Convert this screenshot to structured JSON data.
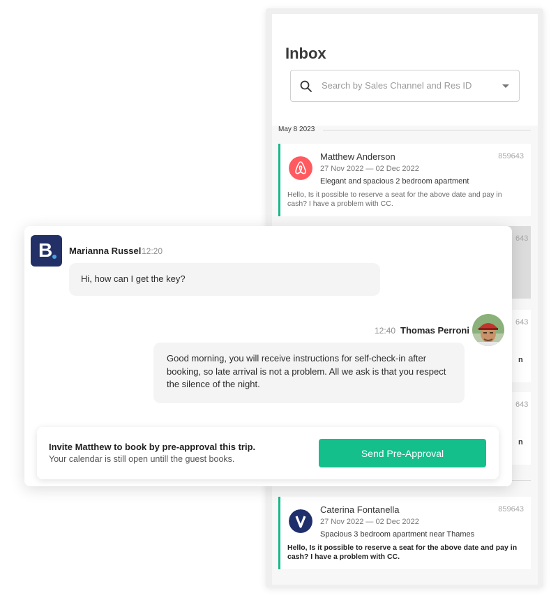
{
  "inbox": {
    "title": "Inbox",
    "search_placeholder": "Search by Sales Channel and Res ID",
    "date_group": "May 8 2023",
    "cards": [
      {
        "name": "Matthew Anderson",
        "res_id": "859643",
        "dates": "27 Nov 2022 — 02 Dec 2022",
        "listing": "Elegant and spacious 2 bedroom apartment",
        "message": "Hello, Is it possible to reserve a seat for the above date and pay in cash? I have a problem with CC.",
        "channel_icon": "airbnb-icon",
        "accent": "#ff5a5f"
      },
      {
        "res_id_fragment": "643"
      },
      {
        "res_id_fragment": "643",
        "text_fragment": "n"
      },
      {
        "res_id_fragment": "643",
        "text_fragment": "n"
      },
      {
        "name": "Caterina Fontanella",
        "res_id": "859643",
        "dates": "27 Nov 2022 — 02 Dec 2022",
        "listing": "Spacious 3 bedroom apartment near Thames",
        "message": "Hello, Is it possible to reserve a seat for the above date and pay in cash? I have a problem with CC.",
        "channel_icon": "vrbo-icon",
        "accent": "#1e2f6b"
      }
    ]
  },
  "chat": {
    "host_message": {
      "sender": "Marianna Russel",
      "time": "12:20",
      "text": "Hi, how can I get the key?",
      "channel_icon": "booking-icon",
      "logo_letter": "B"
    },
    "reply_message": {
      "sender": "Thomas Perroni",
      "time": "12:40",
      "text": "Good morning, you will receive instructions for self-check-in after booking, so late arrival is not a problem. All we ask is that you respect the silence of the night."
    },
    "cta": {
      "title": "Invite Matthew to book by pre-approval this trip.",
      "subtitle": "Your calendar is still open untill the guest books.",
      "button_label": "Send Pre-Approval"
    }
  },
  "colors": {
    "accent_green": "#14bf8c",
    "booking_navy": "#233067",
    "airbnb_red": "#ff5a5f"
  }
}
